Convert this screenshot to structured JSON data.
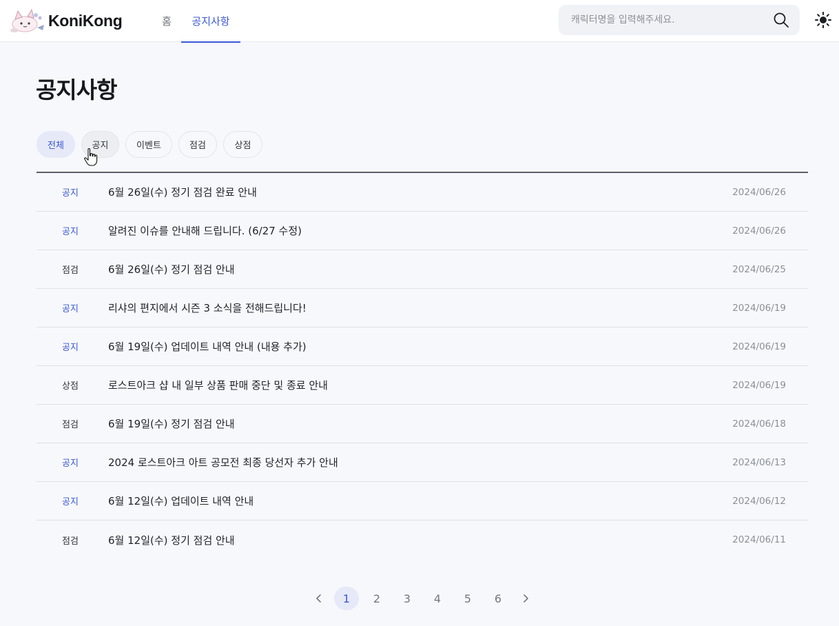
{
  "header": {
    "logo_text": "KoniKong",
    "nav": [
      {
        "label": "홈"
      },
      {
        "label": "공지사항"
      }
    ],
    "search_placeholder": "캐릭터명을 입력해주세요.",
    "search_icon": "magnifier-icon",
    "theme_icon": "sun-icon"
  },
  "page": {
    "title": "공지사항"
  },
  "filters": [
    {
      "label": "전체",
      "active": true
    },
    {
      "label": "공지"
    },
    {
      "label": "이벤트"
    },
    {
      "label": "점검"
    },
    {
      "label": "상점"
    }
  ],
  "notices": [
    {
      "category": "공지",
      "title": "6월 26일(수) 정기 점검 완료 안내",
      "date": "2024/06/26"
    },
    {
      "category": "공지",
      "title": "알려진 이슈를 안내해 드립니다. (6/27 수정)",
      "date": "2024/06/26"
    },
    {
      "category": "점검",
      "title": "6월 26일(수) 정기 점검 안내",
      "date": "2024/06/25"
    },
    {
      "category": "공지",
      "title": "리샤의 편지에서 시즌 3 소식을 전해드립니다!",
      "date": "2024/06/19"
    },
    {
      "category": "공지",
      "title": "6월 19일(수) 업데이트 내역 안내 (내용 추가)",
      "date": "2024/06/19"
    },
    {
      "category": "상점",
      "title": "로스트아크 샵 내 일부 상품 판매 중단 및 종료 안내",
      "date": "2024/06/19"
    },
    {
      "category": "점검",
      "title": "6월 19일(수) 정기 점검 안내",
      "date": "2024/06/18"
    },
    {
      "category": "공지",
      "title": "2024 로스트아크 아트 공모전 최종 당선자 추가 안내",
      "date": "2024/06/13"
    },
    {
      "category": "공지",
      "title": "6월 12일(수) 업데이트 내역 안내",
      "date": "2024/06/12"
    },
    {
      "category": "점검",
      "title": "6월 12일(수) 정기 점검 안내",
      "date": "2024/06/11"
    }
  ],
  "pagination": {
    "pages": [
      "1",
      "2",
      "3",
      "4",
      "5",
      "6"
    ],
    "current": "1",
    "prev_icon": "chevron-left-icon",
    "next_icon": "chevron-right-icon"
  },
  "colors": {
    "accent": "#3a58d6",
    "background": "#f7f8fb",
    "active_chip_bg": "#e6e9f7"
  }
}
